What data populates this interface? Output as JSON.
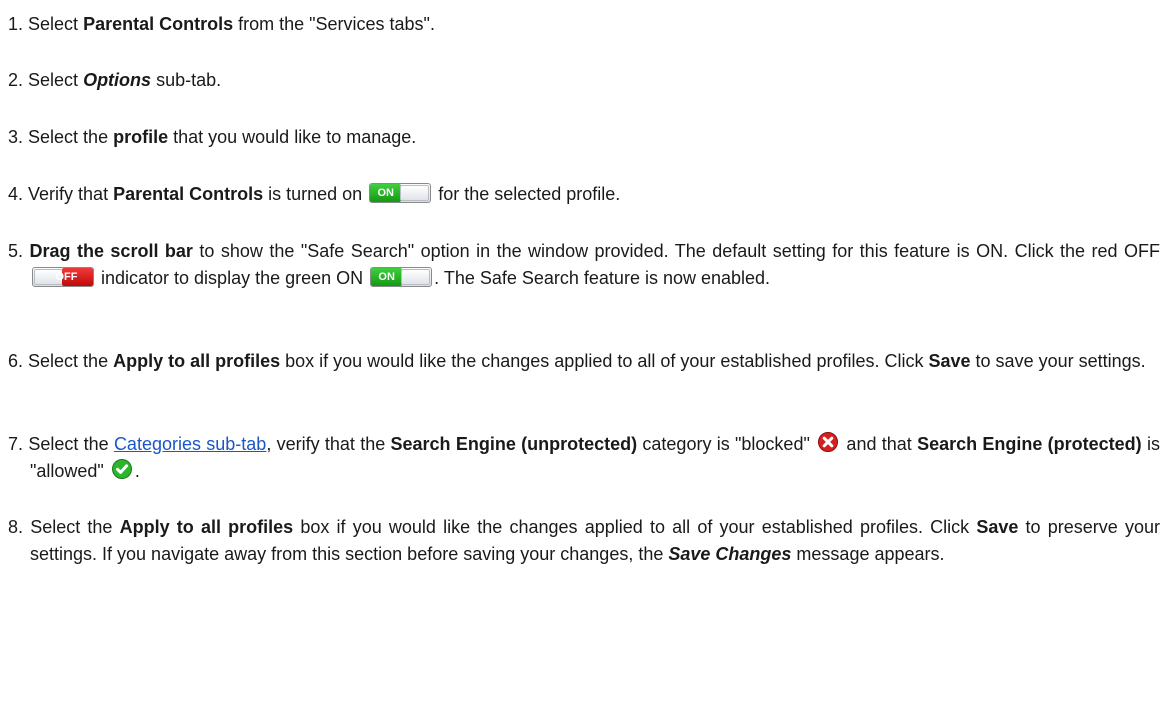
{
  "steps": [
    {
      "num": "1.",
      "parts": [
        "Select ",
        "Parental Controls",
        " from the \"Services tabs\"."
      ]
    },
    {
      "num": "2.",
      "parts": [
        "Select ",
        "Options",
        " sub-tab."
      ]
    },
    {
      "num": "3.",
      "parts": [
        "Select the ",
        "profile",
        " that you would like to manage."
      ]
    },
    {
      "num": "4.",
      "parts": [
        "Verify that ",
        "Parental Controls",
        " is turned on",
        " for the selected profile."
      ]
    },
    {
      "num": "5.",
      "parts": [
        "Drag the scroll bar",
        " to show the \"Safe Search\" option in the window provided. The default setting for this feature is ON. Click the red OFF ",
        " indicator to display the green ON ",
        ". The Safe Search feature is now enabled."
      ]
    },
    {
      "num": "6.",
      "parts": [
        "Select the ",
        "Apply to all profiles",
        " box if you would like the changes applied to all of your established profiles. Click ",
        "Save",
        " to save your settings."
      ]
    },
    {
      "num": "7.",
      "parts": [
        "Select the ",
        "Categories sub-tab",
        ", verify that the ",
        "Search Engine (unprotected)",
        " category is \"blocked\" ",
        " and that ",
        "Search Engine (protected)",
        " is \"allowed\" ",
        "."
      ]
    },
    {
      "num": "8.",
      "parts": [
        "Select the ",
        "Apply to all profiles",
        " box if you would like the changes applied to all of your established profiles. Click ",
        "Save",
        " to preserve your settings. If you navigate away from this section before saving your changes, the ",
        "Save Changes",
        " message appears."
      ]
    }
  ],
  "toggles": {
    "on_label": "ON",
    "off_label": "OFF"
  },
  "colors": {
    "on": "#1fae1f",
    "off": "#d61515",
    "link": "#1a56c8",
    "blocked": "#d62020",
    "allowed": "#2db52d"
  }
}
